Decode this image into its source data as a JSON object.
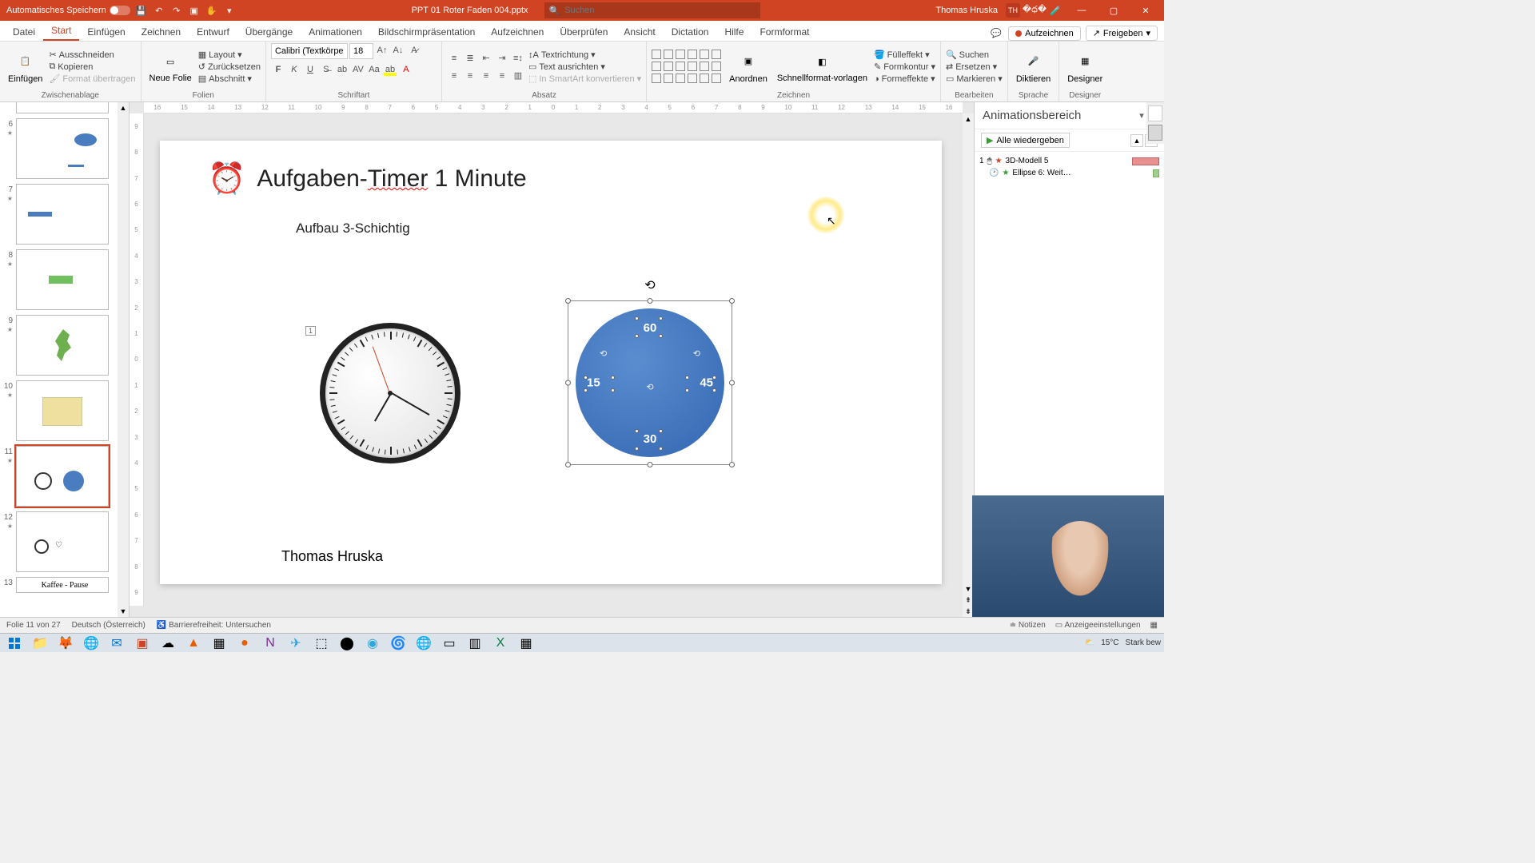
{
  "titlebar": {
    "autosave": "Automatisches Speichern",
    "filename": "PPT 01 Roter Faden 004.pptx",
    "search_placeholder": "Suchen",
    "user_name": "Thomas Hruska",
    "user_initials": "TH"
  },
  "tabs": {
    "datei": "Datei",
    "start": "Start",
    "einfuegen": "Einfügen",
    "zeichnen": "Zeichnen",
    "entwurf": "Entwurf",
    "uebergaenge": "Übergänge",
    "animationen": "Animationen",
    "bildschirm": "Bildschirmpräsentation",
    "aufzeichnen": "Aufzeichnen",
    "ueberpruefen": "Überprüfen",
    "ansicht": "Ansicht",
    "dictation": "Dictation",
    "hilfe": "Hilfe",
    "formformat": "Formformat",
    "btn_aufzeichnen": "Aufzeichnen",
    "btn_freigeben": "Freigeben"
  },
  "ribbon": {
    "clipboard": {
      "label": "Zwischenablage",
      "einfuegen": "Einfügen",
      "ausschneiden": "Ausschneiden",
      "kopieren": "Kopieren",
      "format": "Format übertragen"
    },
    "folien": {
      "label": "Folien",
      "neue": "Neue Folie",
      "layout": "Layout",
      "zuruecksetzen": "Zurücksetzen",
      "abschnitt": "Abschnitt"
    },
    "schriftart": {
      "label": "Schriftart",
      "fontname": "Calibri (Textkörper)",
      "fontsize": "18"
    },
    "absatz": {
      "label": "Absatz",
      "textrichtung": "Textrichtung",
      "ausrichten": "Text ausrichten",
      "smartart": "In SmartArt konvertieren"
    },
    "zeichnen": {
      "label": "Zeichnen",
      "anordnen": "Anordnen",
      "schnellformat": "Schnellformat-vorlagen",
      "fuelleffekt": "Fülleffekt",
      "formkontur": "Formkontur",
      "formeffekte": "Formeffekte"
    },
    "bearbeiten": {
      "label": "Bearbeiten",
      "suchen": "Suchen",
      "ersetzen": "Ersetzen",
      "markieren": "Markieren"
    },
    "sprache": {
      "label": "Sprache",
      "diktieren": "Diktieren"
    },
    "designer": {
      "label": "Designer",
      "designer": "Designer"
    }
  },
  "slides": {
    "items": [
      {
        "num": "6"
      },
      {
        "num": "7"
      },
      {
        "num": "8"
      },
      {
        "num": "9"
      },
      {
        "num": "10"
      },
      {
        "num": "11"
      },
      {
        "num": "12"
      },
      {
        "num": "13"
      }
    ],
    "handwritten": "Kaffee - Pause"
  },
  "slide": {
    "title_pre": "Aufgaben-",
    "title_timer": "Timer",
    "title_post": " 1 Minute",
    "subtitle": "Aufbau 3-Schichtig",
    "author": "Thomas Hruska",
    "anim_tag": "1",
    "blue": {
      "n60": "60",
      "n45": "45",
      "n30": "30",
      "n15": "15"
    }
  },
  "anim_pane": {
    "title": "Animationsbereich",
    "play_all": "Alle wiedergeben",
    "items": [
      {
        "num": "1",
        "name": "3D-Modell 5"
      },
      {
        "name": "Ellipse 6: Weit…"
      }
    ]
  },
  "status": {
    "slide": "Folie 11 von 27",
    "lang": "Deutsch (Österreich)",
    "access": "Barrierefreiheit: Untersuchen",
    "notes": "Notizen",
    "display": "Anzeigeeinstellungen"
  },
  "taskbar": {
    "temp": "15°C",
    "weather": "Stark bew"
  },
  "ruler_h": [
    "16",
    "15",
    "14",
    "13",
    "12",
    "11",
    "10",
    "9",
    "8",
    "7",
    "6",
    "5",
    "4",
    "3",
    "2",
    "1",
    "0",
    "1",
    "2",
    "3",
    "4",
    "5",
    "6",
    "7",
    "8",
    "9",
    "10",
    "11",
    "12",
    "13",
    "14",
    "15",
    "16"
  ],
  "ruler_v": [
    "9",
    "8",
    "7",
    "6",
    "5",
    "4",
    "3",
    "2",
    "1",
    "0",
    "1",
    "2",
    "3",
    "4",
    "5",
    "6",
    "7",
    "8",
    "9"
  ]
}
